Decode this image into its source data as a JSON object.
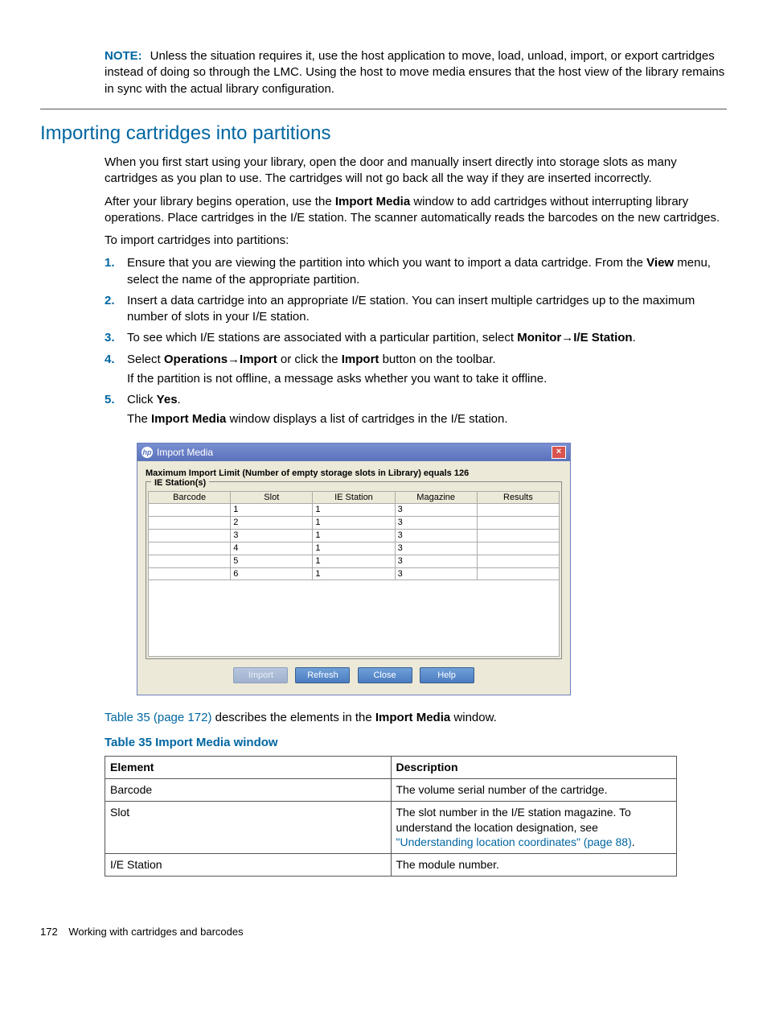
{
  "note": {
    "label": "NOTE:",
    "text": "Unless the situation requires it, use the host application to move, load, unload, import, or export cartridges instead of doing so through the LMC. Using the host to move media ensures that the host view of the library remains in sync with the actual library configuration."
  },
  "section_title": "Importing cartridges into partitions",
  "intro1": "When you first start using your library, open the door and manually insert directly into storage slots as many cartridges as you plan to use. The cartridges will not go back all the way if they are inserted incorrectly.",
  "intro2a": "After your library begins operation, use the ",
  "intro2b": "Import Media",
  "intro2c": " window to add cartridges without interrupting library operations. Place cartridges in the I/E station. The scanner automatically reads the barcodes on the new cartridges.",
  "intro3": "To import cartridges into partitions:",
  "steps": {
    "s1a": "Ensure that you are viewing the partition into which you want to import a data cartridge. From the ",
    "s1b": "View",
    "s1c": " menu, select the name of the appropriate partition.",
    "s2": "Insert a data cartridge into an appropriate I/E station. You can insert multiple cartridges up to the maximum number of slots in your I/E station.",
    "s3a": "To see which I/E stations are associated with a particular partition, select ",
    "s3b": "Monitor",
    "s3c": "I/E Station",
    "s3d": ".",
    "s4a": "Select ",
    "s4b": "Operations",
    "s4c": "Import",
    "s4d": " or click the ",
    "s4e": "Import",
    "s4f": " button on the toolbar.",
    "s4_body": "If the partition is not offline, a message asks whether you want to take it offline.",
    "s5a": "Click ",
    "s5b": "Yes",
    "s5c": "."
  },
  "s5_body_a": "The ",
  "s5_body_b": "Import Media",
  "s5_body_c": " window displays a list of cartridges in the I/E station.",
  "dialog": {
    "title": "Import Media",
    "limit": "Maximum Import Limit (Number of empty storage slots in Library) equals 126",
    "legend": "IE Station(s)",
    "headers": [
      "Barcode",
      "Slot",
      "IE Station",
      "Magazine",
      "Results"
    ],
    "rows": [
      {
        "barcode": "",
        "slot": "1",
        "ie": "1",
        "mag": "3",
        "res": ""
      },
      {
        "barcode": "",
        "slot": "2",
        "ie": "1",
        "mag": "3",
        "res": ""
      },
      {
        "barcode": "",
        "slot": "3",
        "ie": "1",
        "mag": "3",
        "res": ""
      },
      {
        "barcode": "",
        "slot": "4",
        "ie": "1",
        "mag": "3",
        "res": ""
      },
      {
        "barcode": "",
        "slot": "5",
        "ie": "1",
        "mag": "3",
        "res": ""
      },
      {
        "barcode": "",
        "slot": "6",
        "ie": "1",
        "mag": "3",
        "res": ""
      }
    ],
    "buttons": {
      "import": "Import",
      "refresh": "Refresh",
      "close": "Close",
      "help": "Help"
    }
  },
  "post_dialog_a": "Table 35 (page 172)",
  "post_dialog_b": " describes the elements in the ",
  "post_dialog_c": "Import Media",
  "post_dialog_d": " window.",
  "table_caption": "Table 35 Import Media window",
  "desc_table": {
    "head": {
      "c1": "Element",
      "c2": "Description"
    },
    "rows": [
      {
        "c1": "Barcode",
        "c2": "The volume serial number of the cartridge."
      },
      {
        "c1": "Slot",
        "c2a": "The slot number in the I/E station magazine. To understand the location designation, see ",
        "c2link": "\"Understanding location coordinates\" (page 88)",
        "c2b": "."
      },
      {
        "c1": "I/E Station",
        "c2": "The module number."
      }
    ]
  },
  "footer": {
    "page": "172",
    "chapter": "Working with cartridges and barcodes"
  }
}
